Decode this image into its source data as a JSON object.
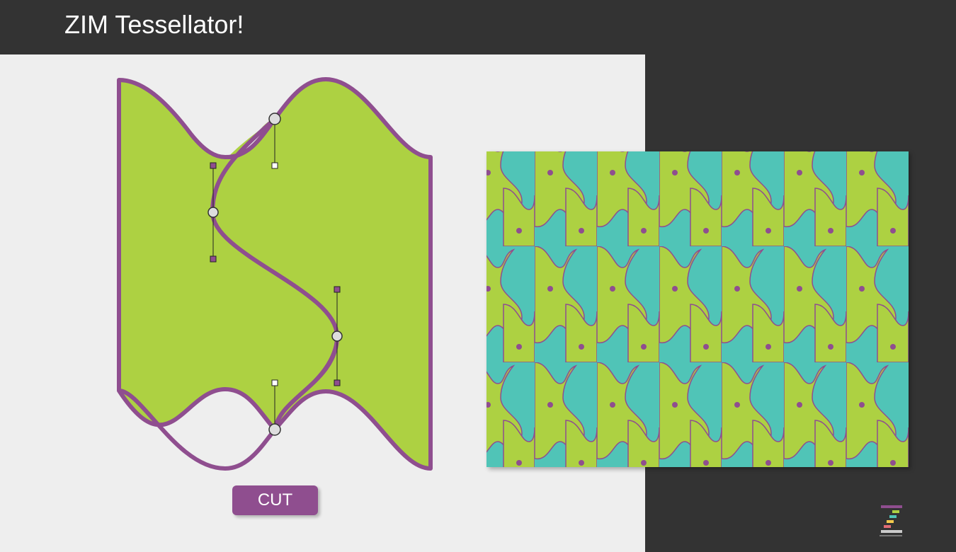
{
  "app": {
    "title": "ZIM Tessellator!"
  },
  "controls": {
    "cut_label": "CUT"
  },
  "colors": {
    "background_dark": "#333333",
    "workspace": "#eeeeee",
    "tile_green": "#add142",
    "tile_teal": "#50c4b7",
    "outline_purple": "#8f4e8f",
    "button": "#8f4e8f"
  },
  "icons": {
    "logo": "zim-logo-icon"
  }
}
